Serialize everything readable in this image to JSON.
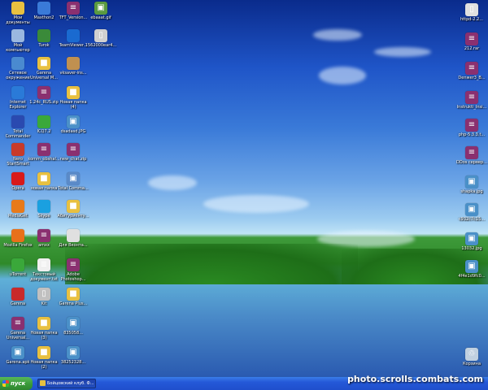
{
  "desktop": {
    "icons": [
      {
        "label": "Мои документы",
        "icon": "documents-icon",
        "color": "#e8c040"
      },
      {
        "label": "Maxthon2",
        "icon": "maxthon-icon",
        "color": "#3a7ad8"
      },
      {
        "label": "TFT_Version...",
        "icon": "winrar-icon",
        "color": "#8a3070"
      },
      {
        "label": "ebaaat.gif",
        "icon": "image-icon",
        "color": "#5a9a40"
      },
      {
        "label": "Мой компьютер",
        "icon": "computer-icon",
        "color": "#9ab8e0"
      },
      {
        "label": "Turok",
        "icon": "game-icon",
        "color": "#3a8a3a"
      },
      {
        "label": "TeamViewer...",
        "icon": "teamviewer-icon",
        "color": "#1a6ad0"
      },
      {
        "label": "1562000ear4...",
        "icon": "file-icon",
        "color": "#d0d0d0"
      },
      {
        "label": "Сетевое окружение",
        "icon": "network-icon",
        "color": "#4a8ad0"
      },
      {
        "label": "Garena Universal M...",
        "icon": "folder-icon",
        "color": "#e8c040"
      },
      {
        "label": "vksaver-ins...",
        "icon": "installer-icon",
        "color": "#c09050"
      },
      {
        "label": "Internet Explorer",
        "icon": "ie-icon",
        "color": "#2a7ad8"
      },
      {
        "label": "1.24c_RUS.zip",
        "icon": "winrar-icon",
        "color": "#8a3070"
      },
      {
        "label": "Новая папка (4)",
        "icon": "folder-icon",
        "color": "#e8c040"
      },
      {
        "label": "Total Commander",
        "icon": "floppy-icon",
        "color": "#2a4ab0"
      },
      {
        "label": "ICQ7.2",
        "icon": "icq-icon",
        "color": "#3aa83a"
      },
      {
        "label": "dsadasd.JPG",
        "icon": "image-icon",
        "color": "#4a90c8"
      },
      {
        "label": "Nero StartSmart",
        "icon": "nero-icon",
        "color": "#c83a2a"
      },
      {
        "label": "komm_obshal...",
        "icon": "winrar-icon",
        "color": "#8a3070"
      },
      {
        "label": "new_chat.zip",
        "icon": "winrar-icon",
        "color": "#8a3070"
      },
      {
        "label": "Opera",
        "icon": "opera-icon",
        "color": "#d81a1a"
      },
      {
        "label": "новая папка",
        "icon": "folder-icon",
        "color": "#e8c040"
      },
      {
        "label": "Total Comma...",
        "icon": "image-icon",
        "color": "#5a8ac8"
      },
      {
        "label": "MediaGet",
        "icon": "mediaget-icon",
        "color": "#e87a1a"
      },
      {
        "label": "Skype",
        "icon": "skype-icon",
        "color": "#1aa0e0"
      },
      {
        "label": "Абитуриенту...",
        "icon": "folder-icon",
        "color": "#e8c040"
      },
      {
        "label": "Mozilla Firefox",
        "icon": "firefox-icon",
        "color": "#e8701a"
      },
      {
        "label": "amxx",
        "icon": "winrar-icon",
        "color": "#8a3070"
      },
      {
        "label": "Для Вконта...",
        "icon": "document-icon",
        "color": "#e0e0e0"
      },
      {
        "label": "uTorrent",
        "icon": "utorrent-icon",
        "color": "#3aa83a"
      },
      {
        "label": "Текстовый документ.txt",
        "icon": "text-icon",
        "color": "#f0f0f0"
      },
      {
        "label": "Adobe Photoshop...",
        "icon": "winrar-icon",
        "color": "#8a3070"
      },
      {
        "label": "Garena",
        "icon": "garena-icon",
        "color": "#c82a2a"
      },
      {
        "label": "Kit",
        "icon": "file-icon",
        "color": "#c0c0c0"
      },
      {
        "label": "Garena Plus...",
        "icon": "folder-icon",
        "color": "#e8c040"
      },
      {
        "label": "Garena Universal...",
        "icon": "winrar-icon",
        "color": "#8a3070"
      },
      {
        "label": "Новая папка (3)",
        "icon": "folder-icon",
        "color": "#e8c040"
      },
      {
        "label": "835058...",
        "icon": "image-icon",
        "color": "#4a90c8"
      },
      {
        "label": "Garena.apk",
        "icon": "image-icon",
        "color": "#4a90c8"
      },
      {
        "label": "Новая папка (2)",
        "icon": "folder-icon",
        "color": "#e8c040"
      },
      {
        "label": "38252328...",
        "icon": "image-icon",
        "color": "#4a90c8"
      },
      {
        "label": "httpd-2.2...",
        "icon": "file-icon",
        "color": "#e0e0e0"
      },
      {
        "label": "212.rar",
        "icon": "winrar-icon",
        "color": "#8a3070"
      },
      {
        "label": "Denwer3_B...",
        "icon": "winrar-icon",
        "color": "#8a3070"
      },
      {
        "label": "Instrukti_Insi...",
        "icon": "winrar-icon",
        "color": "#8a3070"
      },
      {
        "label": "php-5.3.3.t...",
        "icon": "winrar-icon",
        "color": "#8a3070"
      },
      {
        "label": "DDos сервер...",
        "icon": "winrar-icon",
        "color": "#8a3070"
      },
      {
        "label": "shapka.jpg",
        "icon": "image-icon",
        "color": "#4a90c8"
      },
      {
        "label": "c932c7c15...",
        "icon": "image-icon",
        "color": "#4a90c8"
      },
      {
        "label": "13032.jpg",
        "icon": "image-icon",
        "color": "#4a90c8"
      },
      {
        "label": "4f4e1d9fc0...",
        "icon": "image-icon",
        "color": "#4a90c8"
      },
      {
        "label": "Корзина",
        "icon": "recycle-bin-icon",
        "color": "#c0d0e0"
      }
    ]
  },
  "taskbar": {
    "start_label": "пуск",
    "window_label": "Бойцовский клуб. Ф..."
  },
  "watermark": "photo.scrolls.combats.com"
}
